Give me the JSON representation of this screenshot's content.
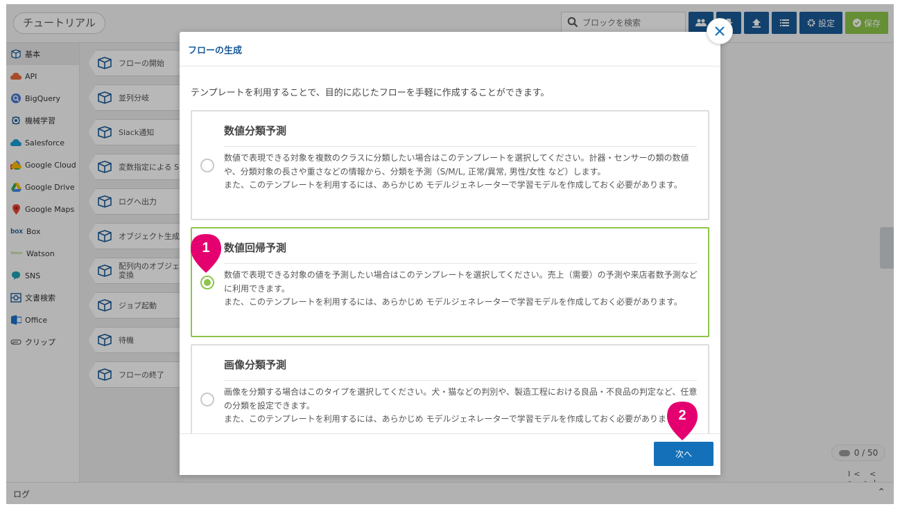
{
  "app": {
    "title": "チュートリアル",
    "search_placeholder": "ブロックを検索",
    "settings_label": "設定",
    "save_label": "保存"
  },
  "sidebar": {
    "items": [
      {
        "label": "基本",
        "icon": "basic-block-icon"
      },
      {
        "label": "API",
        "icon": "api-cloud-icon"
      },
      {
        "label": "BigQuery",
        "icon": "bigquery-icon"
      },
      {
        "label": "機械学習",
        "icon": "machine-learning-icon"
      },
      {
        "label": "Salesforce",
        "icon": "salesforce-icon"
      },
      {
        "label": "Google Cloud",
        "icon": "google-cloud-icon"
      },
      {
        "label": "Google Drive",
        "icon": "google-drive-icon"
      },
      {
        "label": "Google Maps",
        "icon": "google-maps-icon"
      },
      {
        "label": "Box",
        "icon": "box-icon"
      },
      {
        "label": "Watson",
        "icon": "watson-icon"
      },
      {
        "label": "SNS",
        "icon": "sns-icon"
      },
      {
        "label": "文書検索",
        "icon": "document-search-icon"
      },
      {
        "label": "Office",
        "icon": "office-icon"
      },
      {
        "label": "クリップ",
        "icon": "clip-icon"
      }
    ]
  },
  "blocks": [
    {
      "label": "フローの開始"
    },
    {
      "label": "並列分岐"
    },
    {
      "label": "Slack通知"
    },
    {
      "label": "変数指定による S"
    },
    {
      "label": "ログへ出力"
    },
    {
      "label": "オブジェクト生成"
    },
    {
      "label": "配列内のオブジェ",
      "label2": "変換"
    },
    {
      "label": "ジョブ起動"
    },
    {
      "label": "待機"
    },
    {
      "label": "フローの終了"
    }
  ],
  "canvas": {
    "counter": "0 / 50",
    "pager": "I< < > >I"
  },
  "log": {
    "label": "ログ"
  },
  "modal": {
    "title": "フローの生成",
    "intro": "テンプレートを利用することで、目的に応じたフローを手軽に作成することができます。",
    "templates": [
      {
        "name": "数値分類予測",
        "selected": false,
        "desc1": "数値で表現できる対象を複数のクラスに分類したい場合はこのテンプレートを選択してください。計器・センサーの類の数値や、分類対象の長さや重さなどの情報から、分類を予測（S/M/L, 正常/異常, 男性/女性 など）します。",
        "desc2": "また、このテンプレートを利用するには、あらかじめ モデルジェネレーターで学習モデルを作成しておく必要があります。"
      },
      {
        "name": "数値回帰予測",
        "selected": true,
        "desc1": "数値で表現できる対象の値を予測したい場合はこのテンプレートを選択してください。売上（需要）の予測や来店者数予測などに利用できます。",
        "desc2": "また、このテンプレートを利用するには、あらかじめ モデルジェネレーターで学習モデルを作成しておく必要があります。"
      },
      {
        "name": "画像分類予測",
        "selected": false,
        "desc1": "画像を分類する場合はこのタイプを選択してください。犬・猫などの判別や、製造工程における良品・不良品の判定など、任意の分類を設定できます。",
        "desc2": "また、このテンプレートを利用するには、あらかじめ モデルジェネレーターで学習モデルを作成しておく必要があります。"
      }
    ],
    "next_label": "次へ"
  },
  "markers": [
    {
      "number": "1"
    },
    {
      "number": "2"
    }
  ],
  "colors": {
    "accent_blue": "#1a5a98",
    "button_blue": "#1470b8",
    "selected_green": "#8cc54a",
    "marker_pink": "#e4006f"
  }
}
